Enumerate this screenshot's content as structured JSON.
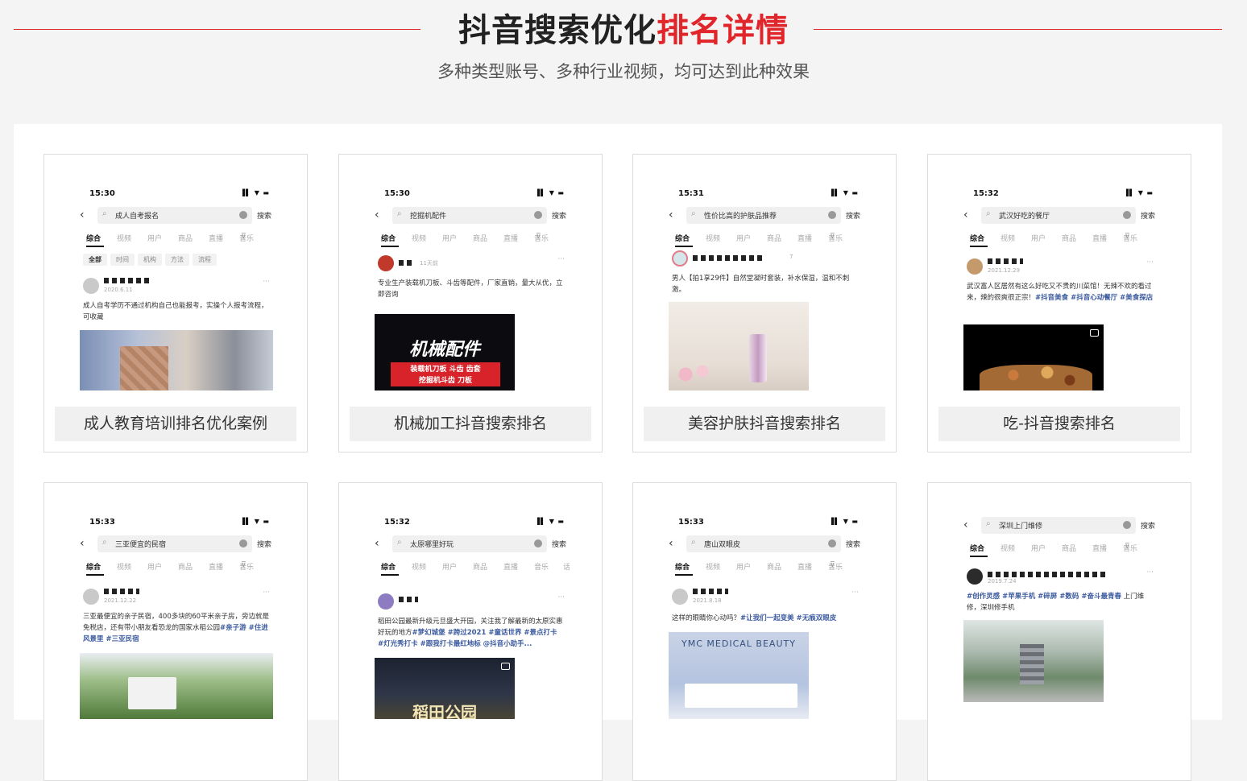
{
  "header": {
    "title_main": "抖音搜索优化",
    "title_accent": "排名详情",
    "subtitle": "多种类型账号、多种行业视频，均可达到此种效果"
  },
  "colors": {
    "accent": "#e0262b",
    "background": "#f4f4f4",
    "hashtag": "#3b5a9f"
  },
  "ui": {
    "back_icon": "chevron-left-icon",
    "search_icon": "magnifier-icon",
    "search_button": "搜索",
    "tabs": [
      "综合",
      "视频",
      "用户",
      "商品",
      "直播",
      "音乐"
    ],
    "tabs_alt": [
      "综合",
      "视频",
      "用户",
      "商品",
      "直播",
      "音乐",
      "话"
    ],
    "filter_icon": "filter-icon",
    "more_icon": "ellipsis-icon",
    "signal": "▐▌ ▼ ▬"
  },
  "cards": [
    {
      "label": "成人教育培训排名优化案例",
      "time": "15:30",
      "query": "成人自考报名",
      "chips": [
        "全部",
        "时间",
        "机构",
        "方法",
        "流程"
      ],
      "date": "2020.6.11",
      "post": "成人自考学历不通过机构自己也能报考，实操个人报考流程，可收藏",
      "tags": ""
    },
    {
      "label": "机械加工抖音搜索排名",
      "time": "15:30",
      "query": "挖掘机配件",
      "date": "11天前",
      "post": "专业生产装载机刀板、斗齿等配件，厂家直销，量大从优，立即咨询",
      "tags": "",
      "thumb_title": "机械配件",
      "thumb_lines": [
        "装载机刀板 斗齿 齿套",
        "挖掘机斗齿 刀板"
      ]
    },
    {
      "label": "美容护肤抖音搜索排名",
      "time": "15:31",
      "query": "性价比高的护肤品推荐",
      "date": "7",
      "post": "男人【拍1享29件】自然堂凝时套装，补水保湿，温和不刺激。",
      "tags": ""
    },
    {
      "label": "吃-抖音搜索排名",
      "time": "15:32",
      "query": "武汉好吃的餐厅",
      "date": "2021.12.29",
      "post": "武汉富人区居然有这么好吃又不贵的川菜馆！无辣不欢的看过来，辣的很爽很正宗！",
      "tags": "#抖音美食 #抖音心动餐厅 #美食探店"
    },
    {
      "label": "",
      "time": "15:33",
      "query": "三亚便宜的民宿",
      "date": "2021.12.22",
      "post": "三亚最便宜的亲子民宿，400多块的60平米亲子房，旁边就是免税店，还有带小朋友看恐龙的国家水稻公园",
      "tags": "#亲子游 #住进风景里 #三亚民宿"
    },
    {
      "label": "",
      "time": "15:32",
      "query": "太原哪里好玩",
      "date": "",
      "post": "稻田公园最新升级元旦盛大开园，关注我了解最新的太原实惠好玩的地方",
      "tags": "#梦幻城堡 #跨过2021 #童话世界 #景点打卡 #灯光秀打卡 #跟我打卡最红地标 @抖音小助手...",
      "thumb_title": "稻田公园"
    },
    {
      "label": "",
      "time": "15:33",
      "query": "唐山双眼皮",
      "date": "2021.8.18",
      "post": "这样的眼睛你心动吗？",
      "tags": "#让我们一起变美 #无痕双眼皮",
      "thumb_title": "YMC MEDICAL BEAUTY"
    },
    {
      "label": "",
      "time": "",
      "query": "深圳上门维修",
      "date": "2019.7.24",
      "post": "上门维修，深圳修手机",
      "tags": "#创作灵感 #苹果手机 #碎屏 #数码 #奋斗最青春"
    }
  ]
}
